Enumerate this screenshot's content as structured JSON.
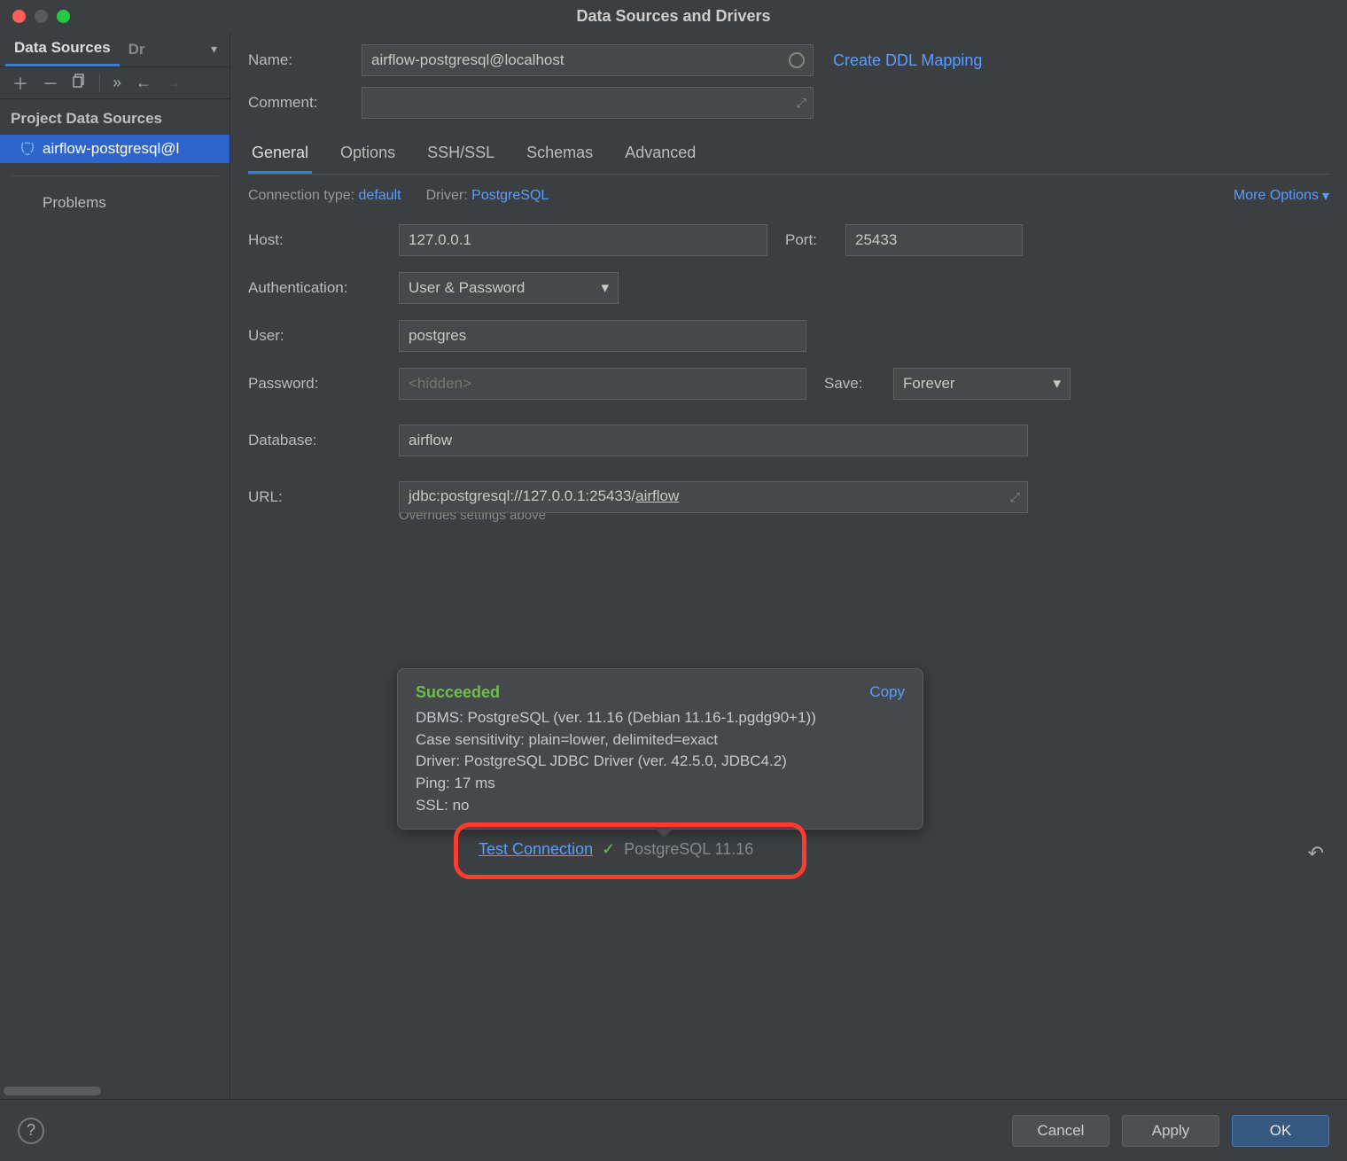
{
  "window": {
    "title": "Data Sources and Drivers"
  },
  "sidebar": {
    "tabs": {
      "active": "Data Sources",
      "truncated": "Dr"
    },
    "section_header": "Project Data Sources",
    "items": [
      {
        "label": "airflow-postgresql@l"
      }
    ],
    "problems": "Problems"
  },
  "header": {
    "name_label": "Name:",
    "name_value": "airflow-postgresql@localhost",
    "ddl_link": "Create DDL Mapping",
    "comment_label": "Comment:",
    "comment_value": ""
  },
  "tabs": [
    "General",
    "Options",
    "SSH/SSL",
    "Schemas",
    "Advanced"
  ],
  "meta": {
    "conn_type_label": "Connection type:",
    "conn_type_value": "default",
    "driver_label": "Driver:",
    "driver_value": "PostgreSQL",
    "more": "More Options"
  },
  "form": {
    "host_label": "Host:",
    "host_value": "127.0.0.1",
    "port_label": "Port:",
    "port_value": "25433",
    "auth_label": "Authentication:",
    "auth_value": "User & Password",
    "user_label": "User:",
    "user_value": "postgres",
    "pass_label": "Password:",
    "pass_placeholder": "<hidden>",
    "save_label": "Save:",
    "save_value": "Forever",
    "db_label": "Database:",
    "db_value": "airflow",
    "url_label": "URL:",
    "url_prefix": "jdbc:postgresql://127.0.0.1:25433/",
    "url_suffix": "airflow",
    "url_helper": "Overrides settings above"
  },
  "popup": {
    "status": "Succeeded",
    "copy": "Copy",
    "lines": [
      "DBMS: PostgreSQL (ver. 11.16 (Debian 11.16-1.pgdg90+1))",
      "Case sensitivity: plain=lower, delimited=exact",
      "Driver: PostgreSQL JDBC Driver (ver. 42.5.0, JDBC4.2)",
      "Ping: 17 ms",
      "SSL: no"
    ]
  },
  "test": {
    "link": "Test Connection",
    "version": "PostgreSQL 11.16"
  },
  "footer": {
    "cancel": "Cancel",
    "apply": "Apply",
    "ok": "OK"
  }
}
